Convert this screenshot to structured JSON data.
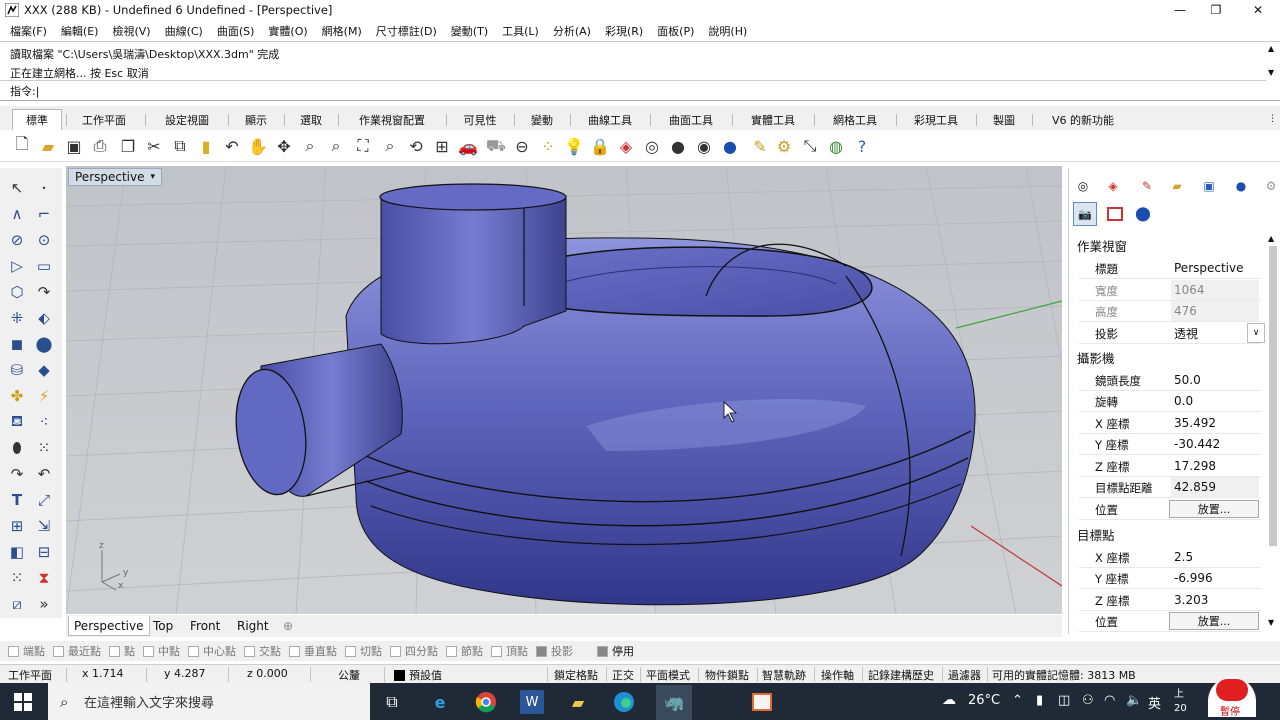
{
  "window": {
    "title": "XXX (288 KB) - Undefined 6 Undefined - [Perspective]",
    "controls": [
      "—",
      "❐",
      "✕"
    ]
  },
  "menu": [
    "檔案(F)",
    "編輯(E)",
    "檢視(V)",
    "曲線(C)",
    "曲面(S)",
    "實體(O)",
    "網格(M)",
    "尺寸標註(D)",
    "變動(T)",
    "工具(L)",
    "分析(A)",
    "彩現(R)",
    "面板(P)",
    "說明(H)"
  ],
  "command": {
    "line1": "讀取檔案 \"C:\\Users\\吳瑞濤\\Desktop\\XXX.3dm\" 完成",
    "line2": "正在建立網格... 按 Esc 取消",
    "prompt": "指令:"
  },
  "tabs": [
    "標準",
    "工作平面",
    "設定視圖",
    "顯示",
    "選取",
    "作業視窗配置",
    "可見性",
    "變動",
    "曲線工具",
    "曲面工具",
    "實體工具",
    "網格工具",
    "彩現工具",
    "製圖",
    "V6 的新功能"
  ],
  "toolbar_icons": [
    "new-icon",
    "open-icon",
    "save-icon",
    "print-icon",
    "import-icon",
    "cut-icon",
    "copy-icon",
    "paste-icon",
    "undo-icon",
    "pan-hand-icon",
    "rotate-icon",
    "zoom-icon",
    "zoom-window-icon",
    "zoom-extents-icon",
    "zoom-selected-icon",
    "rotate-view-icon",
    "layout-icon",
    "car-icon",
    "car-outline-icon",
    "circle-tool-icon",
    "points-icon",
    "light-icon",
    "lock-icon",
    "layer-icon",
    "color-wheel-icon",
    "sphere-icon",
    "sphere-shaded-icon",
    "sphere-blue-icon",
    "pen-icon",
    "settings-gear-icon",
    "transform-icon",
    "globe-icon",
    "help-icon"
  ],
  "viewport": {
    "title": "Perspective",
    "axis_labels": {
      "x": "x",
      "y": "y",
      "z": "z"
    }
  },
  "view_tabs": [
    "Perspective",
    "Top",
    "Front",
    "Right",
    "⊕"
  ],
  "panel": {
    "section_viewport": "作業視窗",
    "viewport_rows": [
      {
        "label": "標題",
        "value": "Perspective",
        "grey": false
      },
      {
        "label": "寬度",
        "value": "1064",
        "grey": true
      },
      {
        "label": "高度",
        "value": "476",
        "grey": true
      },
      {
        "label": "投影",
        "value": "透視",
        "grey": false
      }
    ],
    "section_camera": "攝影機",
    "camera_rows": [
      {
        "label": "鏡頭長度",
        "value": "50.0"
      },
      {
        "label": "旋轉",
        "value": "0.0"
      },
      {
        "label": "X 座標",
        "value": "35.492"
      },
      {
        "label": "Y 座標",
        "value": "-30.442"
      },
      {
        "label": "Z 座標",
        "value": "17.298"
      },
      {
        "label": "目標點距離",
        "value": "42.859"
      }
    ],
    "position_label": "位置",
    "place_button": "放置...",
    "section_target": "目標點",
    "target_rows": [
      {
        "label": "X 座標",
        "value": "2.5"
      },
      {
        "label": "Y 座標",
        "value": "-6.996"
      },
      {
        "label": "Z 座標",
        "value": "3.203"
      }
    ]
  },
  "osnaps": [
    "端點",
    "最近點",
    "點",
    "中點",
    "中心點",
    "交點",
    "垂直點",
    "切點",
    "四分點",
    "節點",
    "頂點",
    "投影",
    "停用"
  ],
  "status": {
    "cplane": "工作平面",
    "x": "x 1.714",
    "y": "y 4.287",
    "z": "z 0.000",
    "units": "公釐",
    "layer": "預設值",
    "grid_snap": "鎖定格點",
    "ortho": "正交",
    "planar": "平面模式",
    "osnap": "物件鎖點",
    "smarttrack": "智慧軌跡",
    "gumball": "操作軸",
    "history": "記錄建構歷史",
    "filter": "過濾器",
    "memory": "可用的實體記憶體: 3813 MB"
  },
  "taskbar": {
    "search_placeholder": "在這裡輸入文字來搜尋",
    "temperature": "26°C",
    "ime": "英",
    "clock_top": "上",
    "clock_bottom": "20",
    "badge": "暫停"
  }
}
